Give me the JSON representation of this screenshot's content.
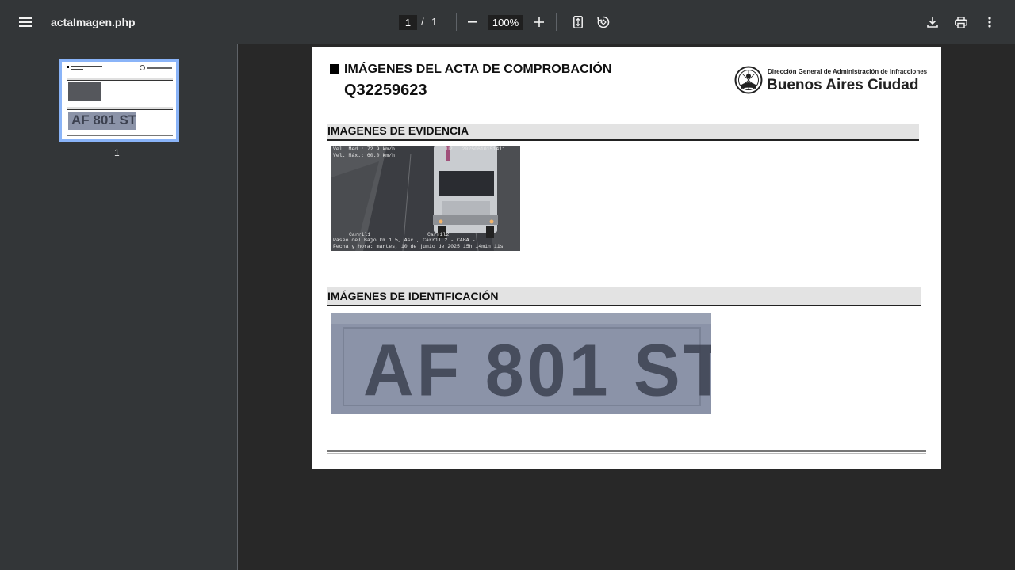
{
  "toolbar": {
    "title": "actaImagen.php",
    "page_current": "1",
    "page_separator": "/",
    "page_total": "1",
    "zoom": "100%"
  },
  "sidebar": {
    "thumb_label": "1",
    "thumb_plate": "AF 801 ST"
  },
  "document": {
    "heading": "IMÁGENES DEL ACTA DE COMPROBACIÓN",
    "code": "Q32259623",
    "logo_subtitle": "Dirección General de Administración de Infracciones",
    "logo_title": "Buenos Aires Ciudad",
    "section_evidence": "IMAGENES DE EVIDENCIA",
    "section_identification": "IMÁGENES DE IDENTIFICACIÓN",
    "evidence_overlay": {
      "speed_measured": "Vel. Med.: 72.9 km/h",
      "speed_max": "Vel. Máx.: 60.0 km/h",
      "device_id": "U2...20250610151411",
      "lane1": "Carril1",
      "lane2": "Carril2",
      "location": "Paseo del Bajo km 1.5, Asc., Carril 2 - CABA -",
      "datetime": "Fecha y hora: martes, 10 de junio de 2025 15h 14min 11s"
    },
    "plate_text": "AF 801 ST"
  }
}
